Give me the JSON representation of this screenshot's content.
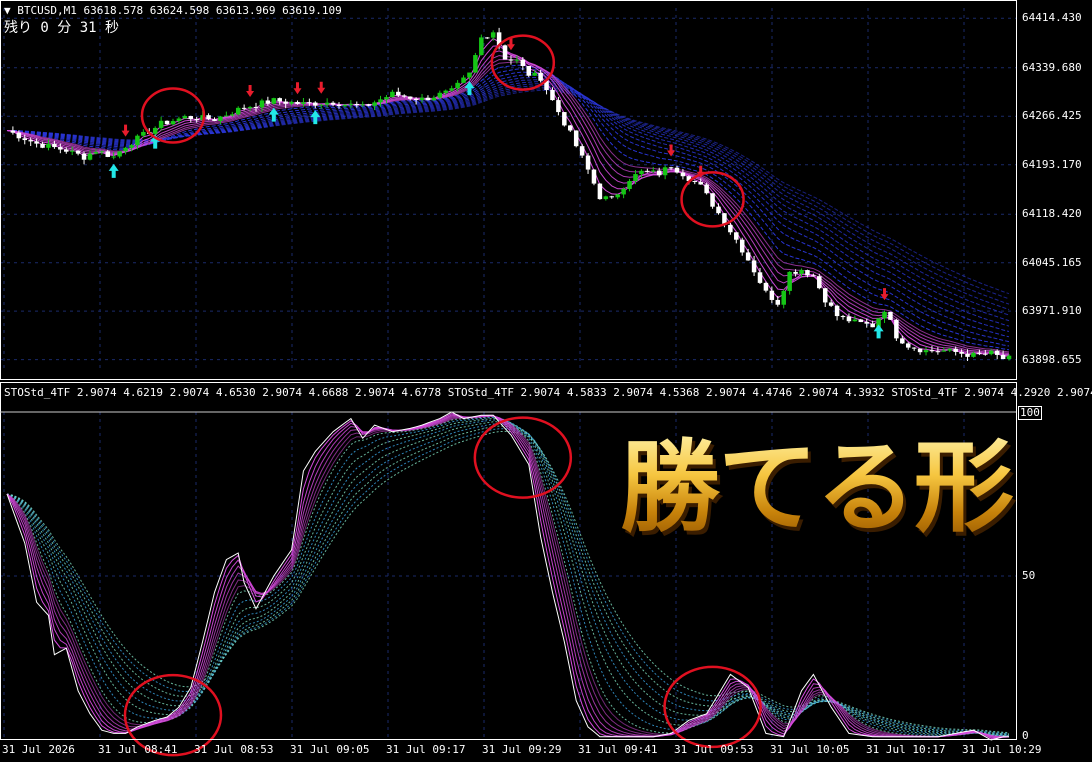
{
  "header": {
    "symbol_line": "▼ BTCUSD,M1  63618.578 63624.598 63613.969 63619.109",
    "countdown": "残り  0 分  31 秒"
  },
  "indicator_header": "STOStd_4TF 2.9074 4.6219 2.9074 4.6530 2.9074 4.6688 2.9074 4.6778  STOStd_4TF 2.9074 4.5833 2.9074 4.5368 2.9074 4.4746 2.9074 4.3932  STOStd_4TF 2.9074 4.2920 2.9074",
  "overlay_text": "勝てる形",
  "colors": {
    "background": "#000000",
    "bull_candle": "#16c616",
    "bear_candle": "#ffffff",
    "ma_ribbon_fast": "#d84be0",
    "ma_ribbon_slow": "#2a36d8",
    "buy_arrow": "#22e8e8",
    "sell_arrow": "#e81c2c",
    "highlight_circle": "#e01020",
    "grid": "#1a2a6a"
  },
  "chart_data": [
    {
      "type": "candlestick",
      "title": "BTCUSD,M1",
      "ylim": [
        63880,
        64430
      ],
      "price_ticks": [
        "64414.430",
        "64339.680",
        "64266.425",
        "64193.170",
        "64118.420",
        "64045.165",
        "63971.910",
        "63898.655"
      ],
      "close_path": [
        [
          0,
          64245
        ],
        [
          5,
          64225
        ],
        [
          10,
          64215
        ],
        [
          13,
          64205
        ],
        [
          15,
          64215
        ],
        [
          18,
          64205
        ],
        [
          20,
          64222
        ],
        [
          23,
          64238
        ],
        [
          26,
          64255
        ],
        [
          30,
          64265
        ],
        [
          35,
          64262
        ],
        [
          40,
          64280
        ],
        [
          45,
          64290
        ],
        [
          50,
          64285
        ],
        [
          55,
          64288
        ],
        [
          60,
          64280
        ],
        [
          65,
          64300
        ],
        [
          70,
          64292
        ],
        [
          75,
          64304
        ],
        [
          78,
          64330
        ],
        [
          80,
          64385
        ],
        [
          82,
          64395
        ],
        [
          84,
          64355
        ],
        [
          86,
          64350
        ],
        [
          88,
          64330
        ],
        [
          90,
          64325
        ],
        [
          92,
          64290
        ],
        [
          95,
          64240
        ],
        [
          98,
          64185
        ],
        [
          100,
          64145
        ],
        [
          102,
          64140
        ],
        [
          105,
          64172
        ],
        [
          107,
          64182
        ],
        [
          110,
          64180
        ],
        [
          112,
          64192
        ],
        [
          114,
          64180
        ],
        [
          117,
          64160
        ],
        [
          120,
          64120
        ],
        [
          123,
          64080
        ],
        [
          125,
          64050
        ],
        [
          128,
          64000
        ],
        [
          130,
          63985
        ],
        [
          132,
          64030
        ],
        [
          134,
          64035
        ],
        [
          136,
          64025
        ],
        [
          138,
          63990
        ],
        [
          140,
          63965
        ],
        [
          143,
          63955
        ],
        [
          146,
          63950
        ],
        [
          148,
          63975
        ],
        [
          150,
          63935
        ],
        [
          152,
          63920
        ],
        [
          155,
          63912
        ],
        [
          158,
          63912
        ],
        [
          160,
          63910
        ],
        [
          163,
          63905
        ],
        [
          166,
          63908
        ],
        [
          168,
          63900
        ]
      ],
      "buy_arrow_bars": [
        18,
        25,
        45,
        52,
        78,
        147
      ],
      "sell_arrow_bars": [
        20,
        41,
        49,
        53,
        85,
        112,
        117,
        148
      ],
      "highlight_circle_bars": [
        28,
        87,
        119
      ]
    },
    {
      "type": "line",
      "title": "STOStd_4TF",
      "ylim": [
        0,
        100
      ],
      "level_labels": [
        "100",
        "50",
        "0"
      ],
      "x_tick_labels": [
        "31 Jul 2026",
        "31 Jul 08:41",
        "31 Jul 08:53",
        "31 Jul 09:05",
        "31 Jul 09:17",
        "31 Jul 09:29",
        "31 Jul 09:41",
        "31 Jul 09:53",
        "31 Jul 10:05",
        "31 Jul 10:17",
        "31 Jul 10:29"
      ],
      "stochastic_path": [
        [
          0,
          75
        ],
        [
          3,
          60
        ],
        [
          5,
          42
        ],
        [
          7,
          38
        ],
        [
          8,
          26
        ],
        [
          10,
          28
        ],
        [
          12,
          15
        ],
        [
          14,
          8
        ],
        [
          16,
          3
        ],
        [
          18,
          2
        ],
        [
          20,
          2
        ],
        [
          22,
          4
        ],
        [
          25,
          6
        ],
        [
          27,
          7
        ],
        [
          29,
          10
        ],
        [
          31,
          16
        ],
        [
          33,
          30
        ],
        [
          35,
          45
        ],
        [
          37,
          55
        ],
        [
          39,
          57
        ],
        [
          40,
          48
        ],
        [
          42,
          40
        ],
        [
          45,
          50
        ],
        [
          48,
          58
        ],
        [
          50,
          82
        ],
        [
          52,
          88
        ],
        [
          55,
          94
        ],
        [
          58,
          98
        ],
        [
          60,
          92
        ],
        [
          62,
          96
        ],
        [
          65,
          94
        ],
        [
          68,
          95
        ],
        [
          70,
          96
        ],
        [
          73,
          98
        ],
        [
          75,
          100
        ],
        [
          77,
          98
        ],
        [
          80,
          99
        ],
        [
          82,
          99
        ],
        [
          85,
          93
        ],
        [
          88,
          84
        ],
        [
          90,
          62
        ],
        [
          92,
          45
        ],
        [
          94,
          30
        ],
        [
          96,
          12
        ],
        [
          98,
          4
        ],
        [
          100,
          1
        ],
        [
          103,
          1
        ],
        [
          106,
          1
        ],
        [
          109,
          1
        ],
        [
          112,
          2
        ],
        [
          115,
          6
        ],
        [
          118,
          8
        ],
        [
          120,
          14
        ],
        [
          122,
          20
        ],
        [
          125,
          16
        ],
        [
          128,
          2
        ],
        [
          131,
          1
        ],
        [
          134,
          15
        ],
        [
          136,
          20
        ],
        [
          139,
          10
        ],
        [
          142,
          2
        ],
        [
          146,
          1
        ],
        [
          150,
          1
        ],
        [
          154,
          1
        ],
        [
          157,
          1
        ],
        [
          160,
          2
        ],
        [
          163,
          3
        ],
        [
          166,
          0
        ],
        [
          168,
          1
        ]
      ],
      "highlight_circle_bars": [
        28,
        87,
        119
      ]
    }
  ]
}
